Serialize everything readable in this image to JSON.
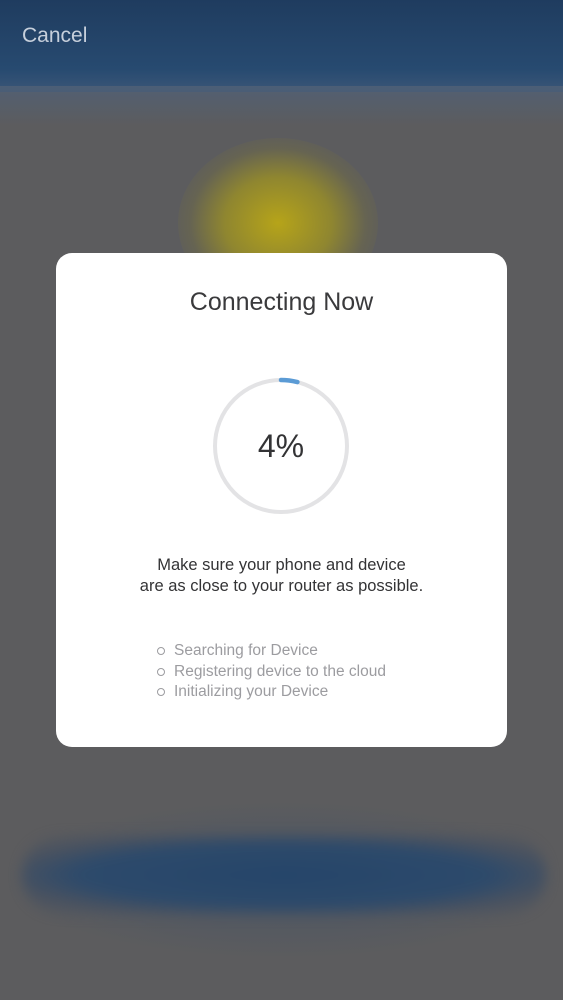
{
  "header": {
    "cancel_label": "Cancel"
  },
  "dialog": {
    "title": "Connecting Now",
    "progress": {
      "percent": 4,
      "label": "4%"
    },
    "hint_lines": [
      "Make sure your phone and device",
      "are as close to your router as possible."
    ],
    "steps": [
      {
        "label": "Searching for Device"
      },
      {
        "label": "Registering device to the cloud"
      },
      {
        "label": "Initializing your Device"
      }
    ]
  },
  "colors": {
    "progress_accent": "#5b9bd5",
    "progress_track": "#e3e3e5",
    "header_bg": "#274a70",
    "dialog_bg": "#ffffff"
  }
}
